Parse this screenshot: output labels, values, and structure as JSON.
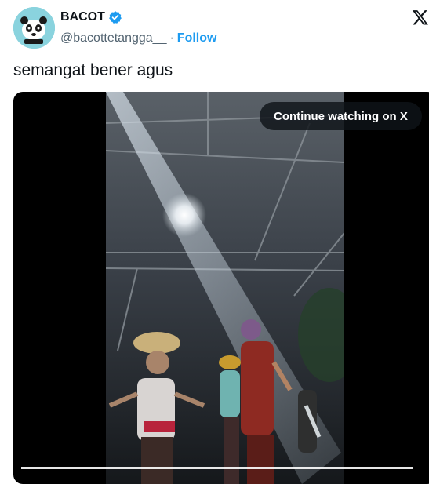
{
  "author": {
    "name": "BACOT",
    "handle": "@bacottetangga__",
    "separator": "·",
    "follow_label": "Follow"
  },
  "tweet": {
    "text": "semangat bener agus"
  },
  "media": {
    "cta_label": "Continue watching on X"
  },
  "colors": {
    "accent": "#1d9bf0",
    "text": "#0f1419",
    "muted": "#536471"
  }
}
